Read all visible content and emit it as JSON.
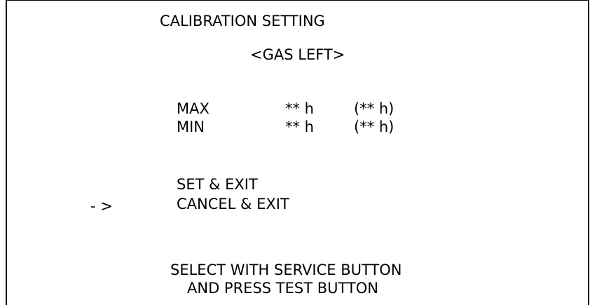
{
  "screen": {
    "title": "CALIBRATION SETTING",
    "subtitle": "<GAS LEFT>"
  },
  "settings": {
    "max": {
      "label": "MAX",
      "value": "** h",
      "prev": "(** h)"
    },
    "min": {
      "label": "MIN",
      "value": "** h",
      "prev": "(** h)"
    }
  },
  "menu": {
    "cursor": "- >",
    "items": [
      {
        "label": "SET & EXIT"
      },
      {
        "label": "CANCEL & EXIT"
      }
    ]
  },
  "footer": {
    "line1": "SELECT WITH SERVICE BUTTON",
    "line2": "AND PRESS TEST BUTTON"
  },
  "colors": {
    "background": "#ffffff",
    "text": "#000000"
  }
}
